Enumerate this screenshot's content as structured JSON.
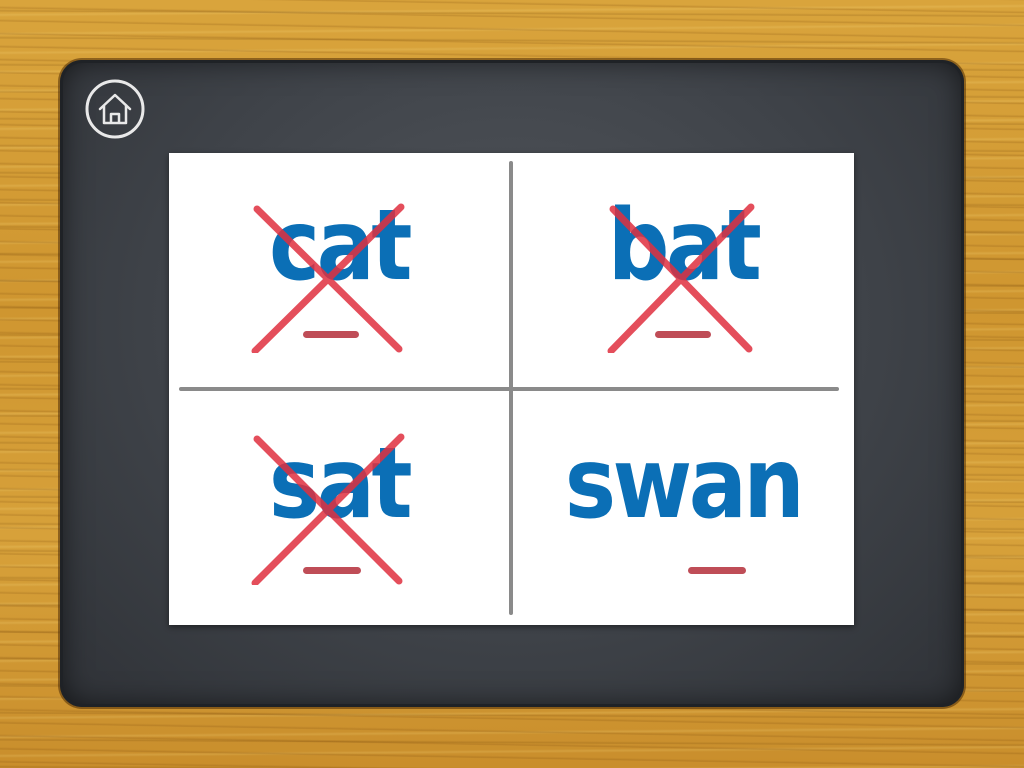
{
  "colors": {
    "word_blue": "#0b6fb6",
    "cross_red": "#e0303f",
    "underline_red": "#b83a45",
    "card_white": "#ffffff",
    "board": "#3f4349",
    "wood": "#d29a35"
  },
  "home_button": {
    "icon": "home-icon"
  },
  "words": [
    {
      "text": "cat",
      "crossed": true
    },
    {
      "text": "bat",
      "crossed": true
    },
    {
      "text": "sat",
      "crossed": true
    },
    {
      "text": "swan",
      "crossed": false
    }
  ]
}
